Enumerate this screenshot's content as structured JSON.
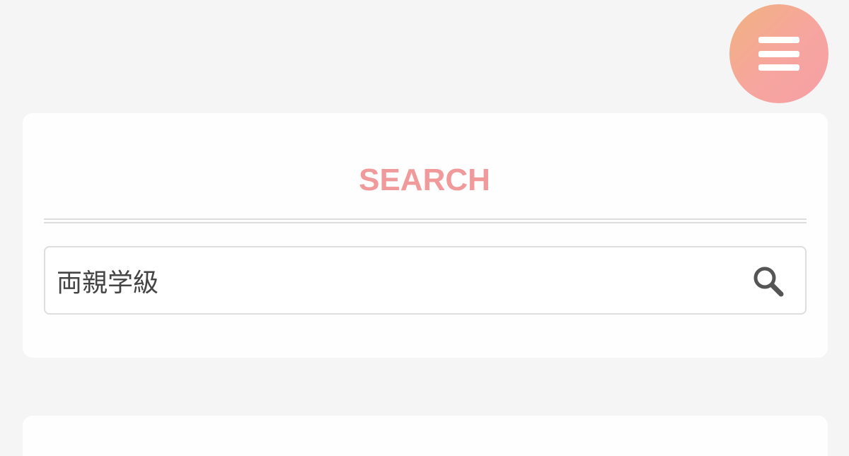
{
  "header": {
    "menu_icon": "hamburger-menu-icon",
    "menu_gradient": [
      "#f0b27f",
      "#f5a0a6"
    ]
  },
  "search_widget": {
    "title": "SEARCH",
    "title_color": "#f19a9b",
    "input_value": "両親学級",
    "search_icon": "search-icon"
  }
}
